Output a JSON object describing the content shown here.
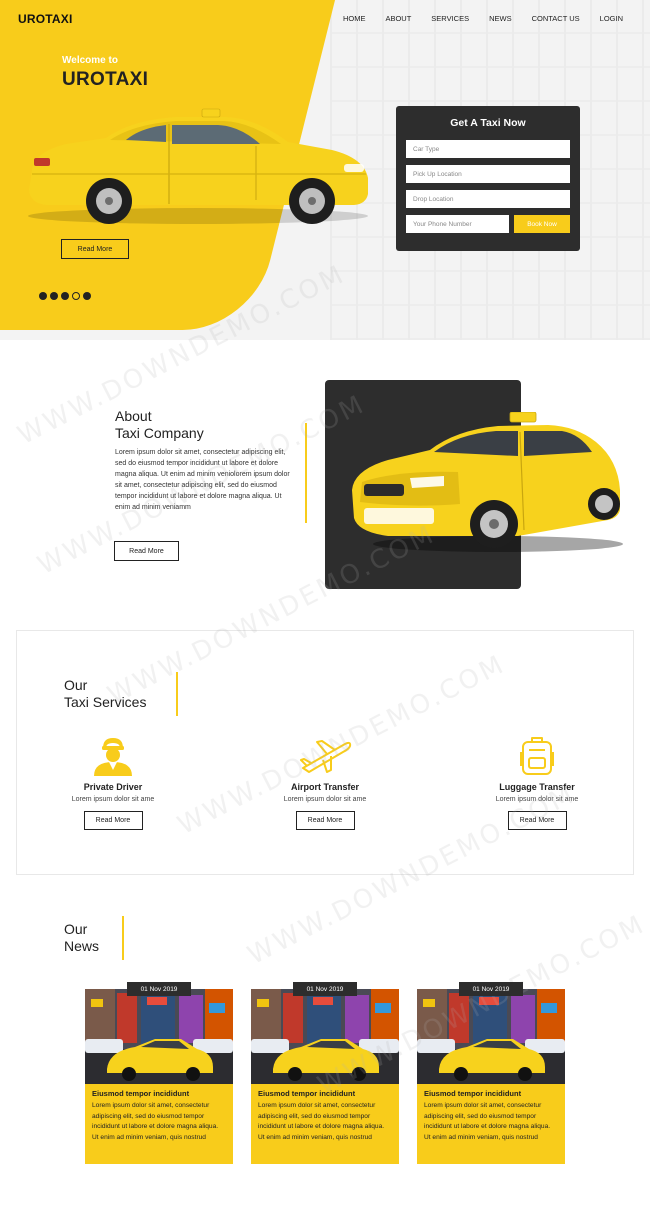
{
  "header": {
    "logo": "UROTAXI",
    "nav": [
      "HOME",
      "ABOUT",
      "SERVICES",
      "NEWS",
      "CONTACT US",
      "LOGIN"
    ]
  },
  "hero": {
    "welcome": "Welcome to",
    "title": "UROTAXI",
    "read_more": "Read More",
    "slider_dots": 5,
    "active_dot": 4
  },
  "taxi_form": {
    "title": "Get A Taxi Now",
    "car_type_placeholder": "Car Type",
    "pickup_placeholder": "Pick Up Location",
    "drop_placeholder": "Drop Location",
    "phone_placeholder": "Your Phone Number",
    "book_label": "Book Now"
  },
  "about": {
    "title_line1": "About",
    "title_line2": "Taxi Company",
    "text": "Lorem ipsum dolor sit amet, consectetur adipiscing elit, sed do eiusmod tempor incididunt ut labore et dolore magna aliqua. Ut enim ad minim veniolorem ipsum dolor sit amet, consectetur adipiscing elit, sed do eiusmod tempor incididunt ut labore et dolore magna aliqua. Ut enim ad minim veniamm",
    "read_more": "Read More"
  },
  "services": {
    "title_line1": "Our",
    "title_line2": "Taxi Services",
    "items": [
      {
        "name": "Private Driver",
        "desc": "Lorem ipsum dolor sit ame",
        "btn": "Read More",
        "icon": "driver-icon"
      },
      {
        "name": "Airport Transfer",
        "desc": "Lorem ipsum dolor sit ame",
        "btn": "Read More",
        "icon": "airplane-icon"
      },
      {
        "name": "Luggage Transfer",
        "desc": "Lorem ipsum dolor sit ame",
        "btn": "Read More",
        "icon": "luggage-icon"
      }
    ]
  },
  "news": {
    "title_line1": "Our",
    "title_line2": "News",
    "items": [
      {
        "date": "01 Nov 2019",
        "title": "Eiusmod tempor incididunt",
        "text": "Lorem ipsum dolor sit amet, consectetur adipiscing elit, sed do eiusmod tempor incididunt ut labore et dolore magna aliqua. Ut enim ad minim veniam, quis nostrud"
      },
      {
        "date": "01 Nov 2019",
        "title": "Eiusmod tempor incididunt",
        "text": "Lorem ipsum dolor sit amet, consectetur adipiscing elit, sed do eiusmod tempor incididunt ut labore et dolore magna aliqua. Ut enim ad minim veniam, quis nostrud"
      },
      {
        "date": "01 Nov 2019",
        "title": "Eiusmod tempor incididunt",
        "text": "Lorem ipsum dolor sit amet, consectetur adipiscing elit, sed do eiusmod tempor incididunt ut labore et dolore magna aliqua. Ut enim ad minim veniam, quis nostrud"
      }
    ]
  },
  "watermark": "WWW.DOWNDEMO.COM",
  "colors": {
    "accent": "#f8cc1b",
    "dark": "#2d2d2d"
  }
}
